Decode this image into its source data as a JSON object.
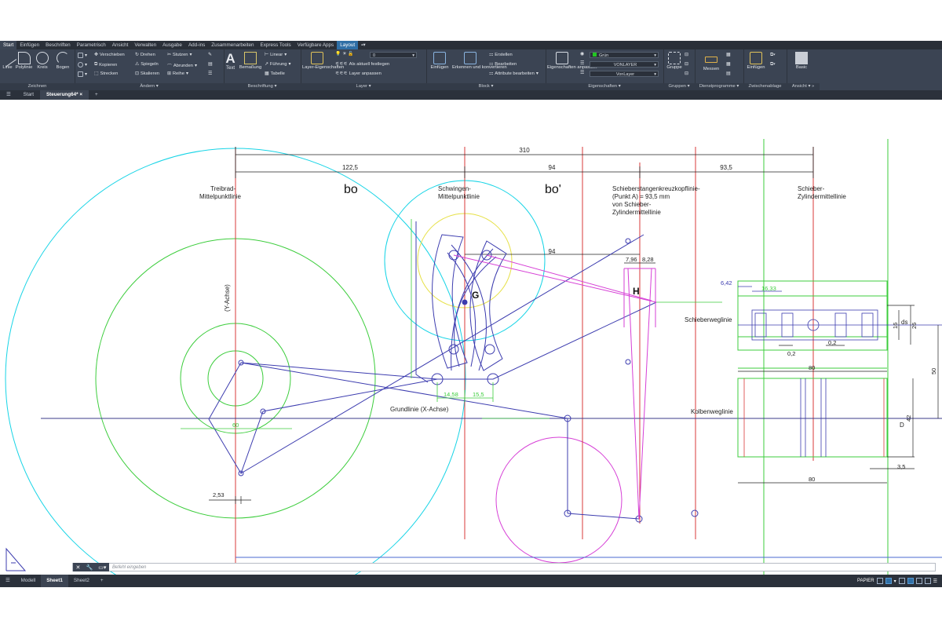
{
  "menu_tabs": [
    "Start",
    "Einfügen",
    "Beschriften",
    "Parametrisch",
    "Ansicht",
    "Verwalten",
    "Ausgabe",
    "Add-ins",
    "Zusammenarbeiten",
    "Express Tools",
    "Verfügbare Apps",
    "Layout"
  ],
  "ribbon": {
    "zeichnen": {
      "label": "Zeichnen",
      "tools": [
        "Linie",
        "Polylinie",
        "Kreis",
        "Bogen"
      ]
    },
    "aendern": {
      "label": "Ändern",
      "items": [
        "Verschieben",
        "Drehen",
        "Stutzen",
        "Kopieren",
        "Spiegeln",
        "Abrunden",
        "Strecken",
        "Skalieren",
        "Reihe"
      ]
    },
    "beschriftung": {
      "label": "Beschriftung",
      "tools": [
        "Text",
        "Bemaßung"
      ],
      "items": [
        "Linear",
        "Führung",
        "Tabelle"
      ]
    },
    "layer": {
      "label": "Layer",
      "tool": "Layer-Eigenschaften",
      "current": "0",
      "items": [
        "Als aktuell festlegen",
        "Layer anpassen"
      ]
    },
    "block": {
      "label": "Block",
      "tools": [
        "Einfügen",
        "Erkennen und konvertieren"
      ],
      "items": [
        "Erstellen",
        "Bearbeiten",
        "Attribute bearbeiten"
      ]
    },
    "eigenschaften": {
      "label": "Eigenschaften",
      "tool": "Eigenschaften anpassen",
      "color": "Grün",
      "linetype": "VONLAYER",
      "lineweight": "VonLayer"
    },
    "gruppen": {
      "label": "Gruppen",
      "tool": "Gruppe"
    },
    "dienstprogramme": {
      "label": "Dienstprogramme",
      "tool": "Messen"
    },
    "zwischenablage": {
      "label": "Zwischenablage",
      "tool": "Einfügen"
    },
    "ansicht": {
      "label": "Ansicht",
      "tool": "Basic"
    }
  },
  "doc_tabs": {
    "start": "Start",
    "current": "Steuerung64*"
  },
  "drawing": {
    "dims": {
      "total": "310",
      "d1": "122,5",
      "d2": "94",
      "d3": "93,5",
      "d4": "94",
      "d5": "7,96",
      "d6": "8,28",
      "d7": "6,42",
      "d8": "16,33",
      "d9": "0,2",
      "d10": "0,2",
      "d11": "80",
      "d12": "80",
      "d13": "16",
      "d14": "26",
      "d15": "50",
      "d16": "42",
      "d17": "3,5",
      "d18": "60",
      "d19": "14,58",
      "d20": "15,5",
      "d21": "2,53"
    },
    "labels": {
      "treibrad": "Treibrad-",
      "treibrad2": "Mittelpunktlinie",
      "bo": "bo",
      "bo2": "bo'",
      "schwingen": "Schwingen-",
      "schwingen2": "Mittelpunktlinie",
      "kreuzkopf1": "Schieberstangenkreuzkopflinie-",
      "kreuzkopf2": "(Punkt A) = 93,5 mm",
      "kreuzkopf3": "von Schieber-",
      "kreuzkopf4": "Zylindermittellinie",
      "schieber1": "Schieber-",
      "schieber2": "Zylindermittellinie",
      "yachse": "(Y-Achse)",
      "grundlinie": "Grundlinie (X-Achse)",
      "G": "G",
      "H": "H",
      "schieberweg": "Schieberweglinie",
      "kolbenweg": "Kolbenweglinie",
      "ds": "ds",
      "D": "D"
    }
  },
  "command_placeholder": "Befehl eingeben",
  "layout_tabs": [
    "Modell",
    "Sheet1",
    "Sheet2"
  ],
  "status": {
    "space": "PAPIER"
  }
}
